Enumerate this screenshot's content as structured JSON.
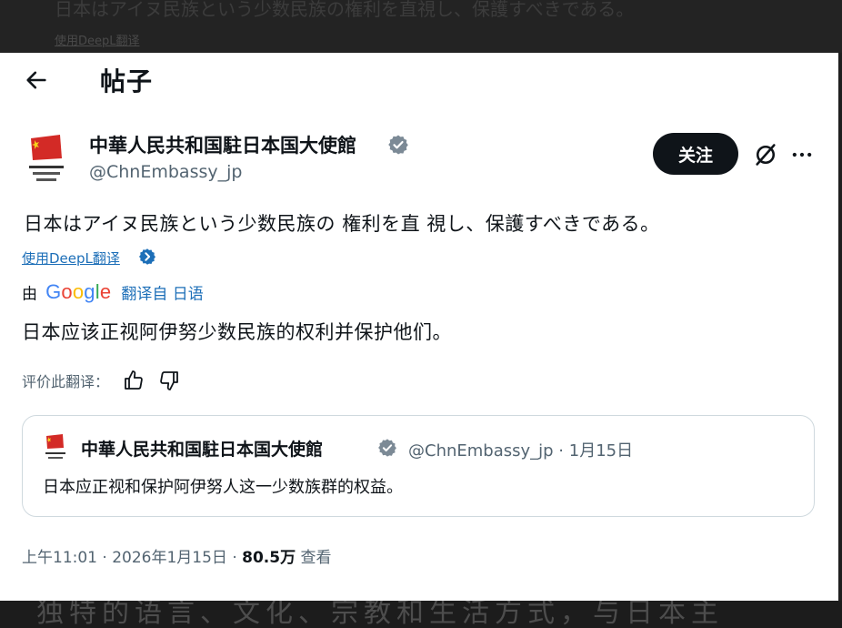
{
  "background": {
    "top_text": "日本はアイヌ民族という少数民族の権利を直視し、保護すべきである。",
    "top_link": "使用DeepL翻译",
    "bottom_text": "独特的语言、文化、宗教和生活方式，与日本主"
  },
  "header": {
    "title": "帖子"
  },
  "author": {
    "name": "中華人民共和国駐日本国大使館",
    "handle": "@ChnEmbassy_jp",
    "follow_label": "关注"
  },
  "post": {
    "text": "日本はアイヌ民族という少数民族の 権利を直 視し、保護すべきである。",
    "deepl_link": "使用DeepL翻译",
    "translated_by": "由",
    "google_logo": "Google",
    "translated_from": "翻译自 日语",
    "translation": "日本应该正视阿伊努少数民族的权利并保护他们。",
    "rate_label": "评价此翻译："
  },
  "quote": {
    "name": "中華人民共和国駐日本国大使館",
    "handle_date": "@ChnEmbassy_jp · 1月15日",
    "text": "日本应正视和保护阿伊努人这一少数族群的权益。"
  },
  "meta": {
    "time_date": "上午11:01 · 2026年1月15日 · ",
    "views": "80.5万",
    "views_label": " 查看"
  },
  "colors": {
    "text": "#0f1419",
    "secondary": "#536471",
    "link": "#1d6fb8",
    "verified": "#7c8a96",
    "follow_bg": "#0f1419",
    "border": "#cfd9de"
  },
  "icons": [
    "back-arrow-icon",
    "verified-badge-icon",
    "grok-icon",
    "more-icon",
    "deepl-chevron-icon",
    "thumbs-up-icon",
    "thumbs-down-icon"
  ]
}
